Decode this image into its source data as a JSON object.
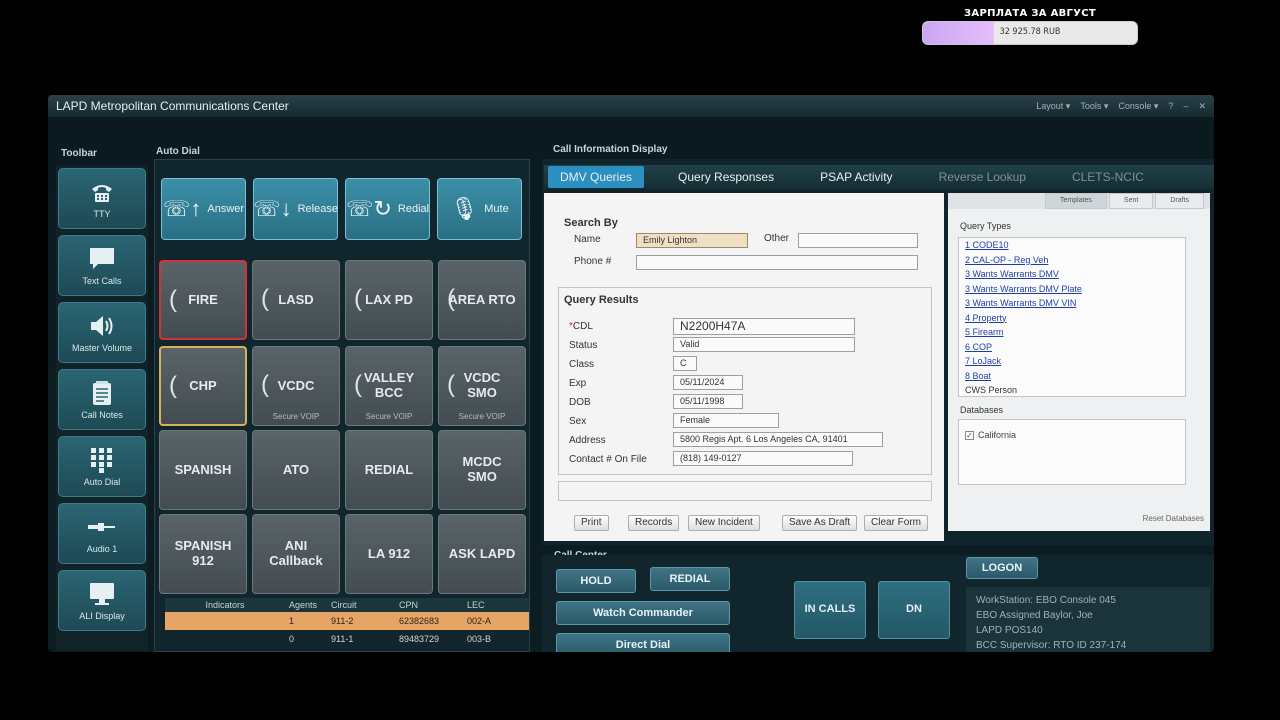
{
  "overlay": {
    "title": "ЗАРПЛАТА ЗА АВГУСТ",
    "value": "32 925.78 RUB",
    "progress": 0.33,
    "fill_color": "#d4b0f5"
  },
  "app": {
    "title": "LAPD Metropolitan Communications Center",
    "menu": [
      "Layout",
      "Tools",
      "Console",
      "?"
    ]
  },
  "toolbar": {
    "label": "Toolbar",
    "items": [
      {
        "label": "TTY",
        "icon": "tty-icon"
      },
      {
        "label": "Text Calls",
        "icon": "message-icon"
      },
      {
        "label": "Master Volume",
        "icon": "speaker-icon"
      },
      {
        "label": "Call Notes",
        "icon": "notepad-icon"
      },
      {
        "label": "Auto Dial",
        "icon": "keypad-icon"
      },
      {
        "label": "Audio 1",
        "icon": "audio-jack-icon"
      },
      {
        "label": "ALI Display",
        "icon": "monitor-icon"
      }
    ]
  },
  "autodial": {
    "label": "Auto Dial",
    "top_buttons": [
      "Answer",
      "Release",
      "Redial",
      "Mute"
    ],
    "grid": [
      {
        "label": "FIRE",
        "sub": ""
      },
      {
        "label": "LASD",
        "sub": ""
      },
      {
        "label": "LAX PD",
        "sub": ""
      },
      {
        "label": "AREA RTO",
        "sub": ""
      },
      {
        "label": "CHP",
        "sub": ""
      },
      {
        "label": "VCDC",
        "sub": "Secure VOIP"
      },
      {
        "label": "VALLEY BCC",
        "sub": "Secure VOIP"
      },
      {
        "label": "VCDC SMO",
        "sub": "Secure VOIP"
      },
      {
        "label": "SPANISH",
        "sub": ""
      },
      {
        "label": "ATO",
        "sub": ""
      },
      {
        "label": "REDIAL",
        "sub": ""
      },
      {
        "label": "MCDC SMO",
        "sub": ""
      },
      {
        "label": "SPANISH 912",
        "sub": ""
      },
      {
        "label": "ANI Callback",
        "sub": ""
      },
      {
        "label": "LA 912",
        "sub": ""
      },
      {
        "label": "ASK LAPD",
        "sub": ""
      }
    ],
    "indicators": {
      "headers": [
        "Indicators",
        "Agents",
        "Circuit",
        "CPN",
        "LEC"
      ],
      "rows": [
        [
          "",
          "1",
          "911-2",
          "62382683",
          "002-A"
        ],
        [
          "",
          "0",
          "911-1",
          "89483729",
          "003-B"
        ]
      ]
    }
  },
  "cid": {
    "label": "Call Information Display",
    "tabs": [
      "DMV Queries",
      "Query Responses",
      "PSAP Activity",
      "Reverse Lookup",
      "CLETS-NCIC"
    ],
    "search_by": "Search By",
    "name_label": "Name",
    "name_value": "Emily Lighton",
    "other_label": "Other",
    "phone_label": "Phone #",
    "query_results": "Query Results",
    "results": [
      {
        "label": "CDL",
        "value": "N2200H47A"
      },
      {
        "label": "Status",
        "value": "Valid"
      },
      {
        "label": "Class",
        "value": "C"
      },
      {
        "label": "Exp",
        "value": "05/11/2024"
      },
      {
        "label": "DOB",
        "value": "05/11/1998"
      },
      {
        "label": "Sex",
        "value": "Female"
      },
      {
        "label": "Address",
        "value": "5800 Regis Apt. 6 Los Angeles CA, 91401"
      },
      {
        "label": "Contact # On File",
        "value": "(818) 149-0127"
      }
    ],
    "buttons": [
      "Print",
      "Records",
      "New Incident",
      "Save As Draft",
      "Clear Form"
    ],
    "right_tabs": [
      "Templates",
      "Sent",
      "Drafts"
    ],
    "query_types_label": "Query Types",
    "query_types": [
      "1  CODE10",
      "2  CAL-OP - Reg Veh",
      "3  Wants   Warrants  DMV",
      "3  Wants   Warrants  DMV  Plate",
      "3  Wants   Warrants  DMV  VIN",
      "4  Property",
      "5  Firearm",
      "6  COP",
      "7  LoJack",
      "8  Boat",
      "CWS Person"
    ],
    "databases_label": "Databases",
    "database_item": "California",
    "reset_label": "Reset Databases"
  },
  "callcenter": {
    "label": "Call Center",
    "hold": "HOLD",
    "redial": "REDIAL",
    "watch_commander": "Watch Commander",
    "direct_dial": "Direct Dial",
    "in_calls": "IN CALLS",
    "dn": "DN",
    "logon": "LOGON",
    "info": [
      "WorkStation: EBO Console 045",
      "EBO Assigned Baylor, Joe",
      "LAPD POS140",
      "BCC Supervisor: RTO ID 237-174"
    ]
  }
}
